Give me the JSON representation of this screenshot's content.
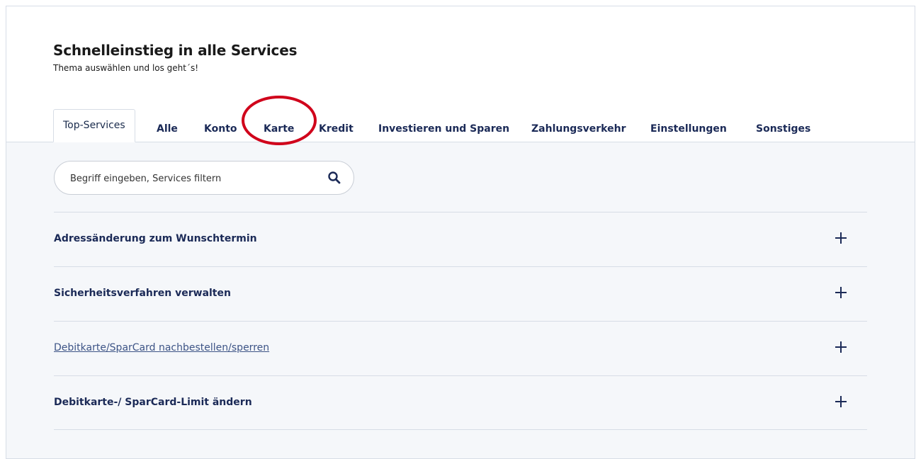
{
  "header": {
    "title": "Schnelleinstieg in alle Services",
    "subtitle": "Thema auswählen und los geht´s!"
  },
  "tabs": [
    {
      "label": "Top-Services",
      "active": true
    },
    {
      "label": "Alle"
    },
    {
      "label": "Konto"
    },
    {
      "label": "Karte"
    },
    {
      "label": "Kredit"
    },
    {
      "label": "Investieren und Sparen"
    },
    {
      "label": "Zahlungsverkehr"
    },
    {
      "label": "Einstellungen"
    },
    {
      "label": "Sonstiges"
    }
  ],
  "search": {
    "placeholder": "Begriff eingeben, Services filtern",
    "icon": "search-icon"
  },
  "services": [
    {
      "label": "Adressänderung zum Wunschtermin"
    },
    {
      "label": "Sicherheitsverfahren verwalten"
    },
    {
      "label": "Debitkarte/SparCard nachbestellen/sperren"
    },
    {
      "label": "Debitkarte-/ SparCard-Limit ändern"
    }
  ],
  "colors": {
    "accent": "#1b2a57",
    "highlight": "#d0021b",
    "panel_background": "#f5f7fa"
  }
}
